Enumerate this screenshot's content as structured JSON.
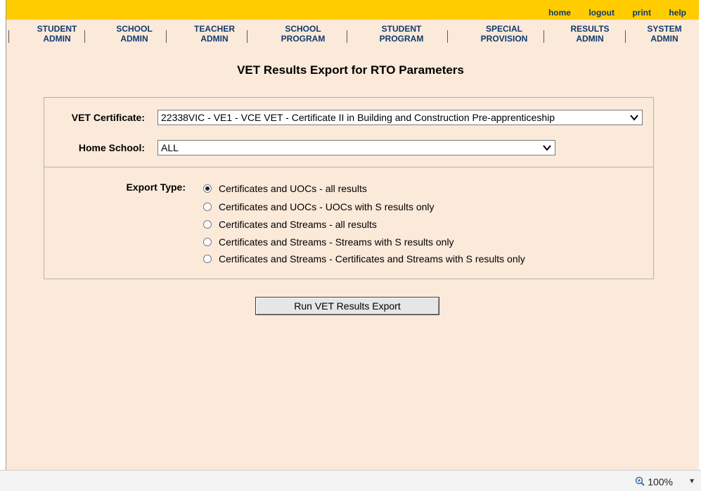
{
  "top_links": [
    "home",
    "logout",
    "print",
    "help"
  ],
  "nav": [
    {
      "line1": "STUDENT",
      "line2": "ADMIN"
    },
    {
      "line1": "SCHOOL",
      "line2": "ADMIN"
    },
    {
      "line1": "TEACHER",
      "line2": "ADMIN"
    },
    {
      "line1": "SCHOOL",
      "line2": "PROGRAM"
    },
    {
      "line1": "STUDENT",
      "line2": "PROGRAM"
    },
    {
      "line1": "SPECIAL",
      "line2": "PROVISION"
    },
    {
      "line1": "RESULTS",
      "line2": "ADMIN"
    },
    {
      "line1": "SYSTEM",
      "line2": "ADMIN"
    }
  ],
  "page_title": "VET Results Export for RTO Parameters",
  "form": {
    "vet_certificate_label": "VET Certificate:",
    "vet_certificate_value": "22338VIC - VE1 - VCE VET - Certificate II in Building and Construction Pre-apprenticeship",
    "home_school_label": "Home School:",
    "home_school_value": "ALL",
    "export_type_label": "Export Type:",
    "export_options": [
      {
        "label": "Certificates and UOCs - all results",
        "checked": true
      },
      {
        "label": "Certificates and UOCs - UOCs with S results only",
        "checked": false
      },
      {
        "label": "Certificates and Streams - all results",
        "checked": false
      },
      {
        "label": "Certificates and Streams - Streams with S results only",
        "checked": false
      },
      {
        "label": "Certificates and Streams - Certificates and Streams with S results only",
        "checked": false
      }
    ],
    "run_button": "Run VET Results Export"
  },
  "status": {
    "zoom": "100%"
  },
  "colors": {
    "header_yellow": "#ffcc00",
    "nav_text": "#0f3a6f",
    "page_bg": "#fbe9da"
  }
}
